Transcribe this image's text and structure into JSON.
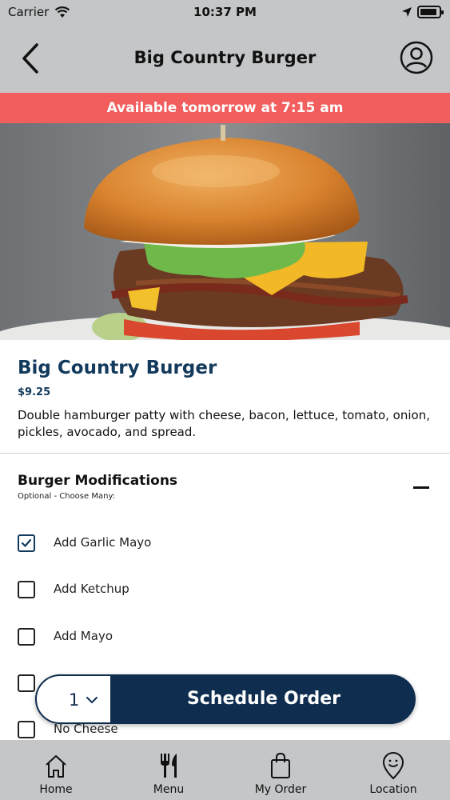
{
  "status_bar": {
    "carrier": "Carrier",
    "time": "10:37 PM"
  },
  "nav": {
    "title": "Big Country Burger",
    "back_icon": "chevron-left-icon",
    "profile_icon": "user-circle-icon"
  },
  "banner": {
    "text": "Available tomorrow at 7:15 am",
    "color": "#f25e5e"
  },
  "product": {
    "name": "Big Country Burger",
    "price": "$9.25",
    "description": "Double hamburger patty with cheese, bacon, lettuce, tomato, onion, pickles, avocado, and spread."
  },
  "modifications": {
    "title": "Burger Modifications",
    "subtitle": "Optional - Choose Many:",
    "options": [
      {
        "label": "Add Garlic Mayo",
        "checked": true
      },
      {
        "label": "Add Ketchup",
        "checked": false
      },
      {
        "label": "Add Mayo",
        "checked": false
      },
      {
        "label": "",
        "checked": false
      },
      {
        "label": "No Cheese",
        "checked": false
      }
    ]
  },
  "order": {
    "quantity": "1",
    "button_label": "Schedule Order",
    "accent": "#0f2d4f"
  },
  "tabs": [
    {
      "label": "Home",
      "icon": "home-icon"
    },
    {
      "label": "Menu",
      "icon": "fork-knife-icon"
    },
    {
      "label": "My Order",
      "icon": "shopping-bag-icon"
    },
    {
      "label": "Location",
      "icon": "location-pin-icon"
    }
  ]
}
